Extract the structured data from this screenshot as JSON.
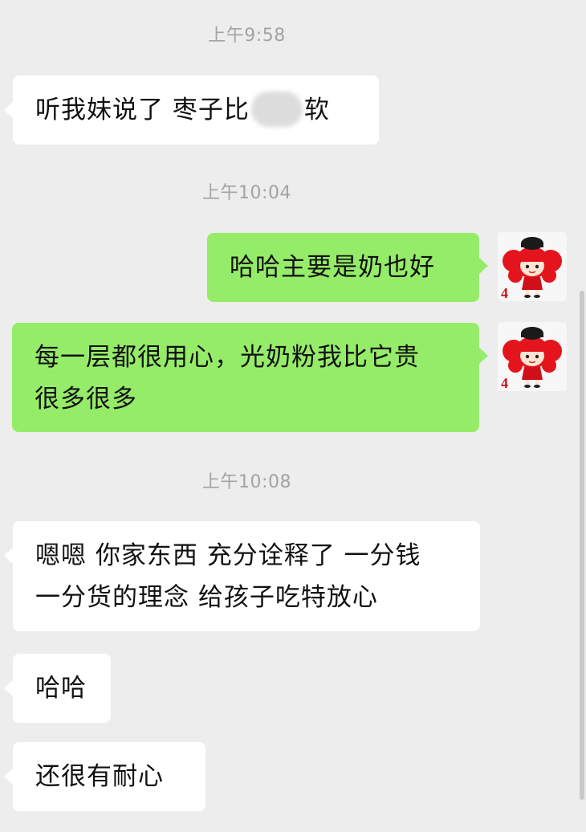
{
  "timestamps": [
    "上午9:58",
    "上午10:04",
    "上午10:08"
  ],
  "msg1": {
    "before": "听我妹说了 枣子比",
    "after": "软"
  },
  "msg2": {
    "text": "哈哈主要是奶也好"
  },
  "msg3": {
    "line1": "每一层都很用心，光奶粉我比它贵",
    "line2": "很多很多"
  },
  "msg4": {
    "line1": "嗯嗯 你家东西 充分诠释了 一分钱",
    "line2": "一分货的理念  给孩子吃特放心"
  },
  "msg5": {
    "text": "哈哈"
  },
  "msg6": {
    "text": "还很有耐心"
  },
  "avatar": {
    "number_badge": "4"
  },
  "colors": {
    "background": "#ededed",
    "sent_bubble": "#95ec69",
    "received_bubble": "#ffffff",
    "timestamp": "#a3a3a3"
  }
}
